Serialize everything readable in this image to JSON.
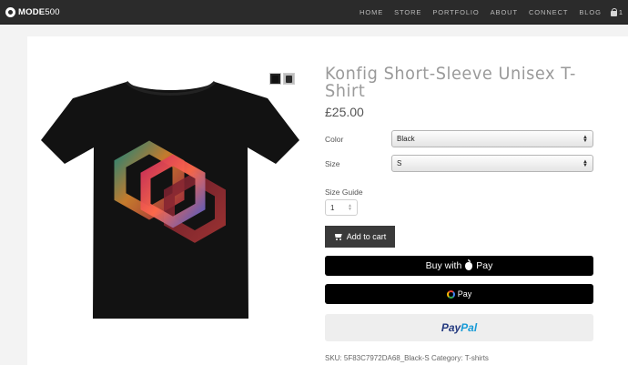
{
  "brand": {
    "name_bold": "MODE",
    "name_light": "500"
  },
  "nav": {
    "items": [
      "HOME",
      "STORE",
      "PORTFOLIO",
      "ABOUT",
      "CONNECT",
      "BLOG"
    ],
    "cart_count": "1"
  },
  "product": {
    "title": "Konfig Short-Sleeve Unisex T-Shirt",
    "price": "£25.00",
    "color_label": "Color",
    "color_value": "Black",
    "size_label": "Size",
    "size_value": "S",
    "size_guide": "Size Guide",
    "quantity": "1",
    "add_to_cart": "Add to cart",
    "apple_pay_prefix": "Buy with",
    "apple_pay_suffix": "Pay",
    "google_pay": "Pay",
    "paypal_a": "Pay",
    "paypal_b": "Pal",
    "sku_line": "SKU: 5F83C7972DA68_Black-S Category: T-shirts"
  },
  "colors": {
    "topbar": "#2b2b2b",
    "background": "#f3f3f3",
    "button_dark": "#3a3a3a",
    "paypal_dark": "#253b80",
    "paypal_light": "#179bd7"
  },
  "icons": [
    "logo-icon",
    "cart-icon",
    "apple-icon",
    "google-g-icon"
  ]
}
